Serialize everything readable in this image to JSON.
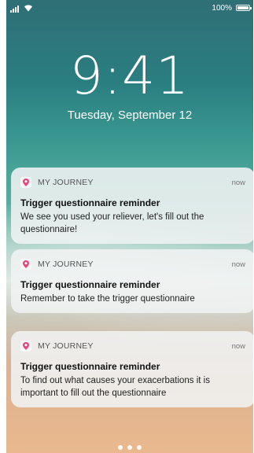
{
  "status": {
    "battery": "100%"
  },
  "lock": {
    "time": "9:41",
    "date": "Tuesday, September 12"
  },
  "notifications": [
    {
      "app": "MY JOURNEY",
      "time": "now",
      "title": "Trigger questionnaire reminder",
      "body": "We see you used your reliever, let's fill out the questionnaire!"
    },
    {
      "app": "MY JOURNEY",
      "time": "now",
      "title": "Trigger questionnaire reminder",
      "body": "Remember to take the trigger questionnaire"
    },
    {
      "app": "MY JOURNEY",
      "time": "now",
      "title": "Trigger questionnaire reminder",
      "body": "To find out what causes your exacerbations it is important to fill out the questionnaire"
    }
  ],
  "colors": {
    "app_icon": "#e6467f"
  }
}
